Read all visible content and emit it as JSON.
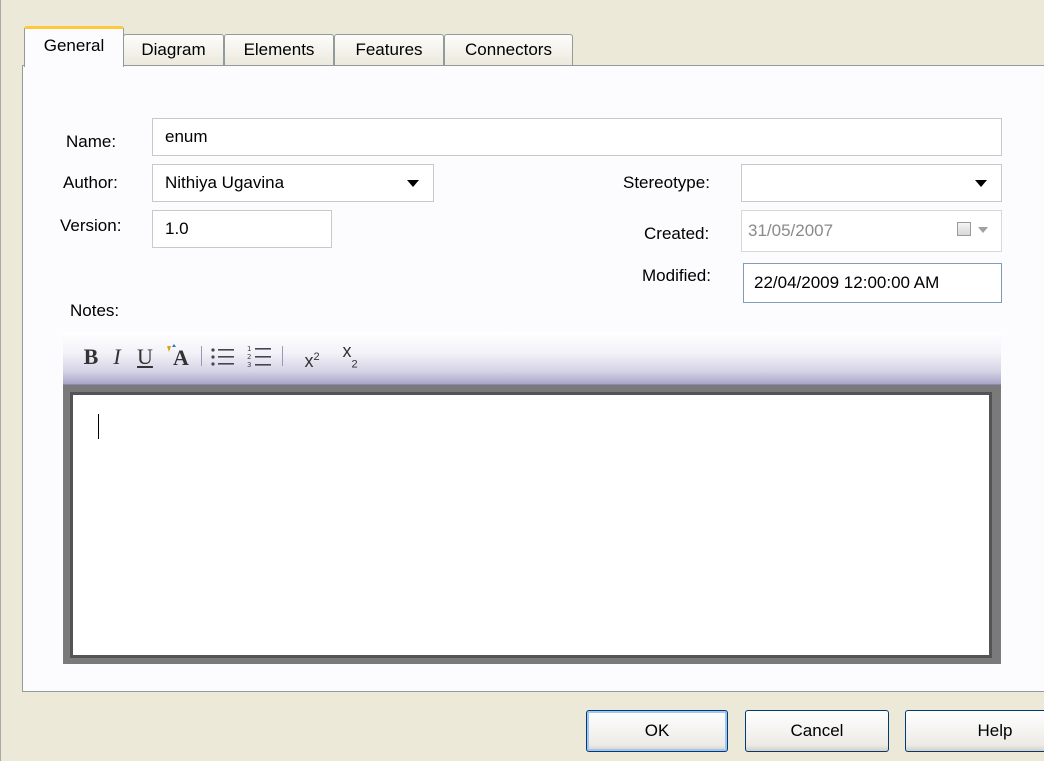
{
  "tabs": [
    {
      "label": "General",
      "active": true
    },
    {
      "label": "Diagram",
      "active": false
    },
    {
      "label": "Elements",
      "active": false
    },
    {
      "label": "Features",
      "active": false
    },
    {
      "label": "Connectors",
      "active": false
    }
  ],
  "form": {
    "name_label": "Name:",
    "name_value": "enum",
    "author_label": "Author:",
    "author_value": "Nithiya Ugavina",
    "version_label": "Version:",
    "version_value": "1.0",
    "stereotype_label": "Stereotype:",
    "stereotype_value": "",
    "created_label": "Created:",
    "created_value": "31/05/2007",
    "modified_label": "Modified:",
    "modified_value": "22/04/2009 12:00:00 AM",
    "notes_label": "Notes:"
  },
  "toolbar": {
    "bold": "B",
    "italic": "I",
    "underline": "U",
    "font_color": "A",
    "sup_base": "x",
    "sup_exp": "2",
    "sub_base": "x",
    "sub_exp": "2"
  },
  "notes_value": "",
  "buttons": {
    "ok": "OK",
    "cancel": "Cancel",
    "help": "Help"
  },
  "colors": {
    "dialog_bg": "#ece9d8",
    "active_tab_highlight": "#ffc83c",
    "button_border": "#003c74"
  }
}
